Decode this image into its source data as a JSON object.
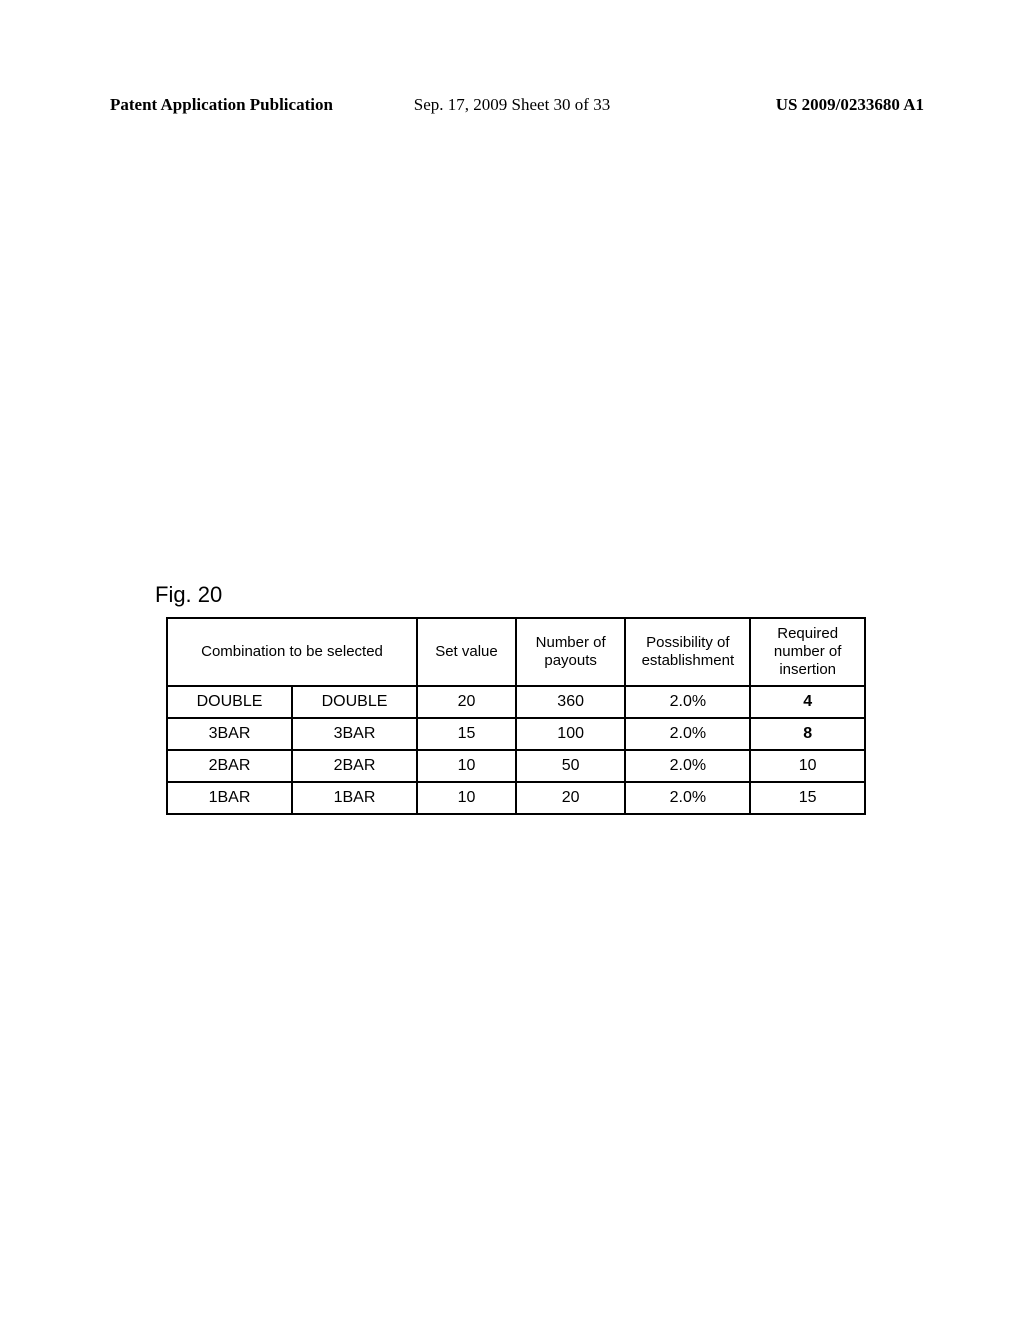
{
  "header": {
    "left": "Patent Application Publication",
    "center": "Sep. 17, 2009  Sheet 30 of 33",
    "right": "US 2009/0233680 A1"
  },
  "figure_label": "Fig. 20",
  "chart_data": {
    "type": "table",
    "title": "Fig. 20",
    "headers": {
      "combination": "Combination to be selected",
      "set_value": "Set value",
      "num_payouts": "Number of payouts",
      "possibility": "Possibility of establishment",
      "required": "Required number of insertion"
    },
    "rows": [
      {
        "combo1": "DOUBLE",
        "combo2": "DOUBLE",
        "set_value": "20",
        "num_payouts": "360",
        "possibility": "2.0%",
        "required": "4"
      },
      {
        "combo1": "3BAR",
        "combo2": "3BAR",
        "set_value": "15",
        "num_payouts": "100",
        "possibility": "2.0%",
        "required": "8"
      },
      {
        "combo1": "2BAR",
        "combo2": "2BAR",
        "set_value": "10",
        "num_payouts": "50",
        "possibility": "2.0%",
        "required": "10"
      },
      {
        "combo1": "1BAR",
        "combo2": "1BAR",
        "set_value": "10",
        "num_payouts": "20",
        "possibility": "2.0%",
        "required": "15"
      }
    ]
  }
}
